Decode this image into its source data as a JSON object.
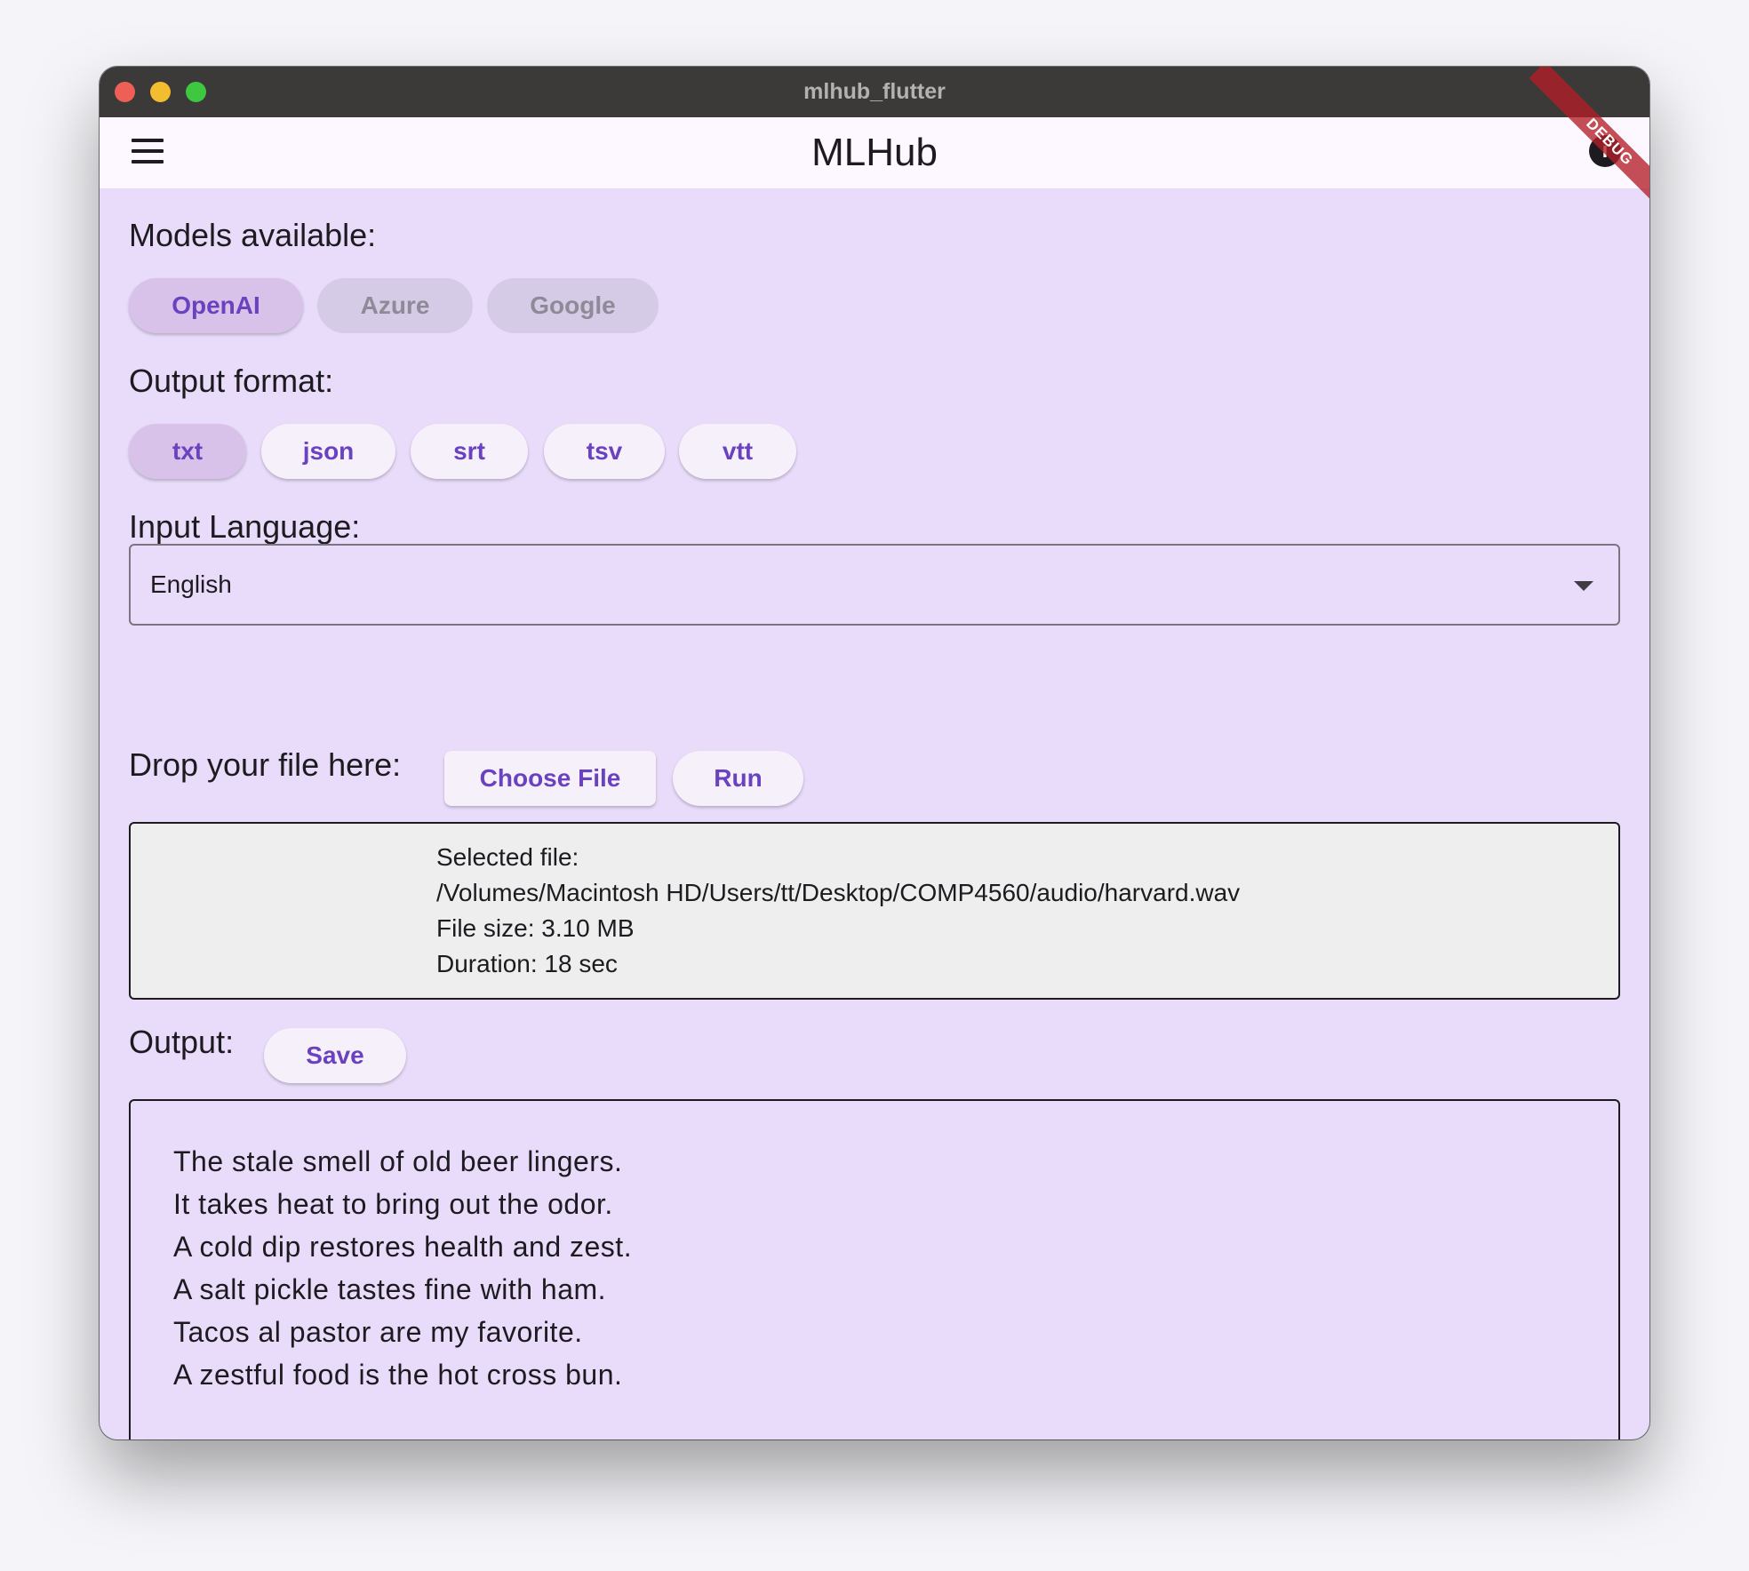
{
  "window": {
    "title": "mlhub_flutter"
  },
  "appbar": {
    "title": "MLHub",
    "info_icon": "info-icon",
    "debug_label": "DEBUG"
  },
  "models": {
    "label": "Models available:",
    "options": [
      "OpenAI",
      "Azure",
      "Google"
    ],
    "selected": "OpenAI",
    "disabled": [
      "Azure",
      "Google"
    ]
  },
  "output_format": {
    "label": "Output format:",
    "options": [
      "txt",
      "json",
      "srt",
      "tsv",
      "vtt"
    ],
    "selected": "txt"
  },
  "input_language": {
    "label": "Input Language:",
    "value": "English"
  },
  "file": {
    "label": "Drop your file here:",
    "choose_label": "Choose File",
    "run_label": "Run",
    "selected_line": "Selected file:",
    "path": "/Volumes/Macintosh HD/Users/tt/Desktop/COMP4560/audio/harvard.wav",
    "size_line": "File size: 3.10 MB",
    "duration_line": "Duration: 18 sec"
  },
  "output": {
    "label": "Output:",
    "save_label": "Save",
    "lines": [
      "The stale smell of old beer lingers.",
      "It takes heat to bring out the odor.",
      "A cold dip restores health and zest.",
      "A salt pickle tastes fine with ham.",
      "Tacos al pastor are my favorite.",
      "A zestful food is the hot cross bun."
    ]
  },
  "colors": {
    "background": "#e8dcfa",
    "accent": "#6a42c0",
    "chip_selected": "#d9c2ea",
    "titlebar": "#3b3a39"
  }
}
